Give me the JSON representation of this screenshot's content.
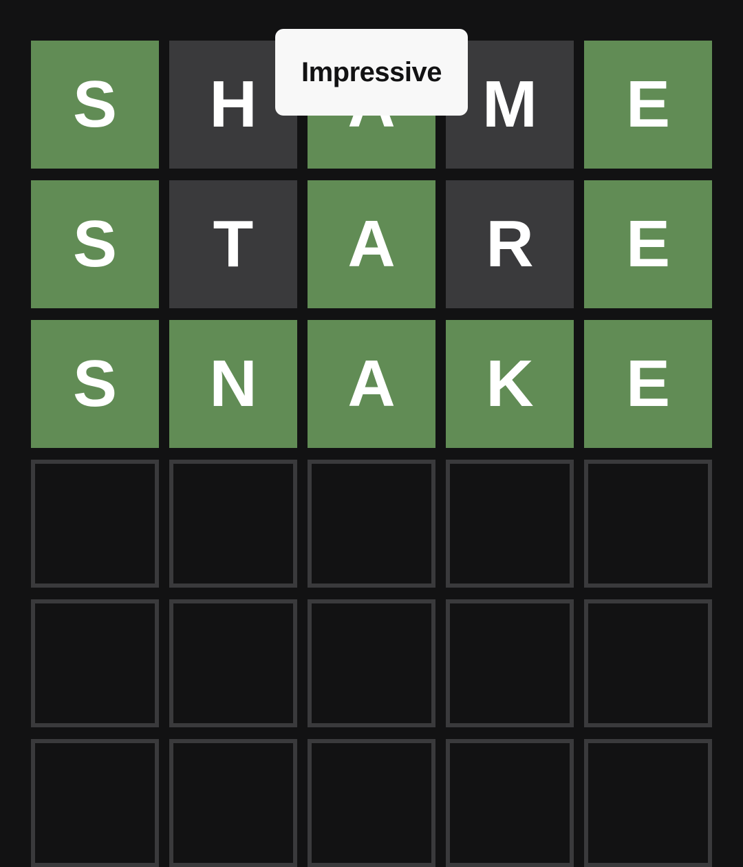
{
  "toast": {
    "message": "Impressive"
  },
  "board": {
    "columns": 5,
    "rows": [
      {
        "tiles": [
          {
            "letter": "S",
            "state": "correct"
          },
          {
            "letter": "H",
            "state": "absent"
          },
          {
            "letter": "A",
            "state": "correct"
          },
          {
            "letter": "M",
            "state": "absent"
          },
          {
            "letter": "E",
            "state": "correct"
          }
        ]
      },
      {
        "tiles": [
          {
            "letter": "S",
            "state": "correct"
          },
          {
            "letter": "T",
            "state": "absent"
          },
          {
            "letter": "A",
            "state": "correct"
          },
          {
            "letter": "R",
            "state": "absent"
          },
          {
            "letter": "E",
            "state": "correct"
          }
        ]
      },
      {
        "tiles": [
          {
            "letter": "S",
            "state": "correct"
          },
          {
            "letter": "N",
            "state": "correct"
          },
          {
            "letter": "A",
            "state": "correct"
          },
          {
            "letter": "K",
            "state": "correct"
          },
          {
            "letter": "E",
            "state": "correct"
          }
        ]
      },
      {
        "tiles": [
          {
            "letter": "",
            "state": "empty"
          },
          {
            "letter": "",
            "state": "empty"
          },
          {
            "letter": "",
            "state": "empty"
          },
          {
            "letter": "",
            "state": "empty"
          },
          {
            "letter": "",
            "state": "empty"
          }
        ]
      },
      {
        "tiles": [
          {
            "letter": "",
            "state": "empty"
          },
          {
            "letter": "",
            "state": "empty"
          },
          {
            "letter": "",
            "state": "empty"
          },
          {
            "letter": "",
            "state": "empty"
          },
          {
            "letter": "",
            "state": "empty"
          }
        ]
      },
      {
        "tiles": [
          {
            "letter": "",
            "state": "empty"
          },
          {
            "letter": "",
            "state": "empty"
          },
          {
            "letter": "",
            "state": "empty"
          },
          {
            "letter": "",
            "state": "empty"
          },
          {
            "letter": "",
            "state": "empty"
          }
        ]
      }
    ]
  },
  "colors": {
    "background": "#121213",
    "correct": "#618c55",
    "absent": "#3a3a3c",
    "empty_border": "#3a3a3c",
    "tile_text": "#ffffff",
    "toast_background": "#f8f8f8",
    "toast_text": "#121213"
  }
}
